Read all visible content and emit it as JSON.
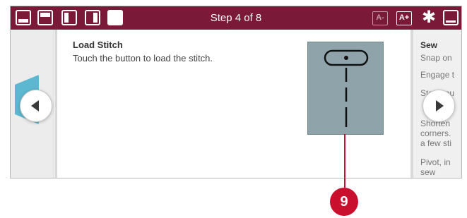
{
  "topbar": {
    "title": "Step 4 of 8",
    "layout_icons": [
      "layout-bottom-icon",
      "layout-top-icon",
      "layout-left-icon",
      "layout-right-icon",
      "layout-full-icon"
    ],
    "font_decrease": "A-",
    "font_increase": "A+",
    "background": "#7b1938"
  },
  "step": {
    "heading": "Load Stitch",
    "text": "Touch the button to load the stitch."
  },
  "next_panel": {
    "title": "Sew",
    "lines": [
      "Snap on",
      "Engage t",
      "Start you",
      "",
      "Shorten",
      "corners.",
      "a few sti",
      "",
      "Pivot, in",
      "sew"
    ]
  },
  "callout": {
    "number": "9",
    "color": "#c8102e"
  },
  "colors": {
    "tab_accent": "#5cb8d1",
    "stitch_button": "#8fa4aa"
  }
}
